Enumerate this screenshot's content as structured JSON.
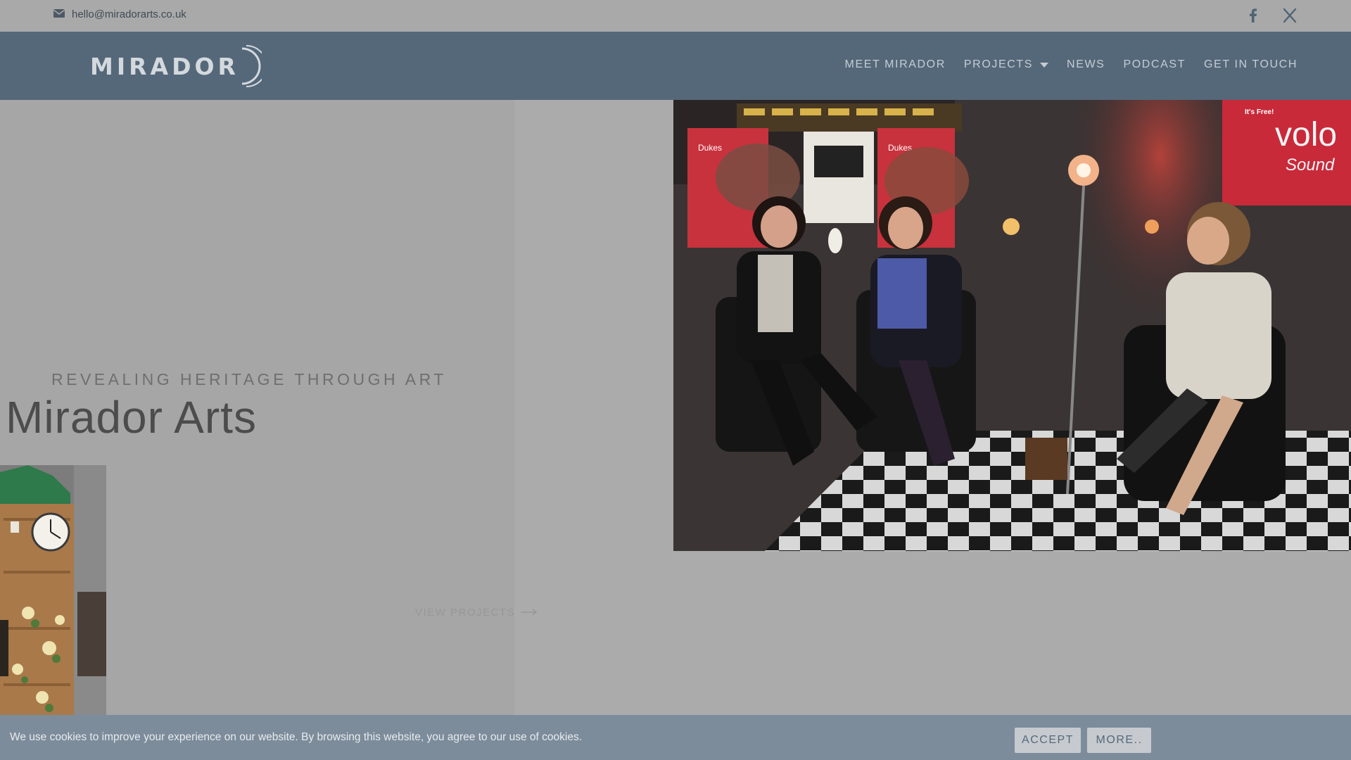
{
  "topbar": {
    "email": "hello@miradorarts.co.uk",
    "icons": [
      "envelope-icon",
      "facebook-icon",
      "x-icon"
    ]
  },
  "nav": {
    "logo": "MIRADOR",
    "items": [
      {
        "label": "MEET MIRADOR"
      },
      {
        "label": "PROJECTS",
        "has_dropdown": true
      },
      {
        "label": "NEWS"
      },
      {
        "label": "PODCAST"
      },
      {
        "label": "GET IN TOUCH"
      }
    ]
  },
  "hero": {
    "tagline": "REVEALING HERITAGE THROUGH ART",
    "title": "Mirador Arts",
    "cta": "VIEW PROJECTS"
  },
  "photo": {
    "posters": [
      "volo",
      "Sound",
      "Dukes",
      "Dukes",
      "It's Free!"
    ]
  },
  "cookie": {
    "message": "We use cookies to improve your experience on our website. By browsing this website, you agree to our use of cookies.",
    "accept": "ACCEPT",
    "more": "MORE.."
  },
  "colors": {
    "nav_bg": "#55687a",
    "topbar_bg": "#a9a9a9",
    "cookie_bg": "#7c8c9b",
    "button_bg": "#c6cacf"
  }
}
